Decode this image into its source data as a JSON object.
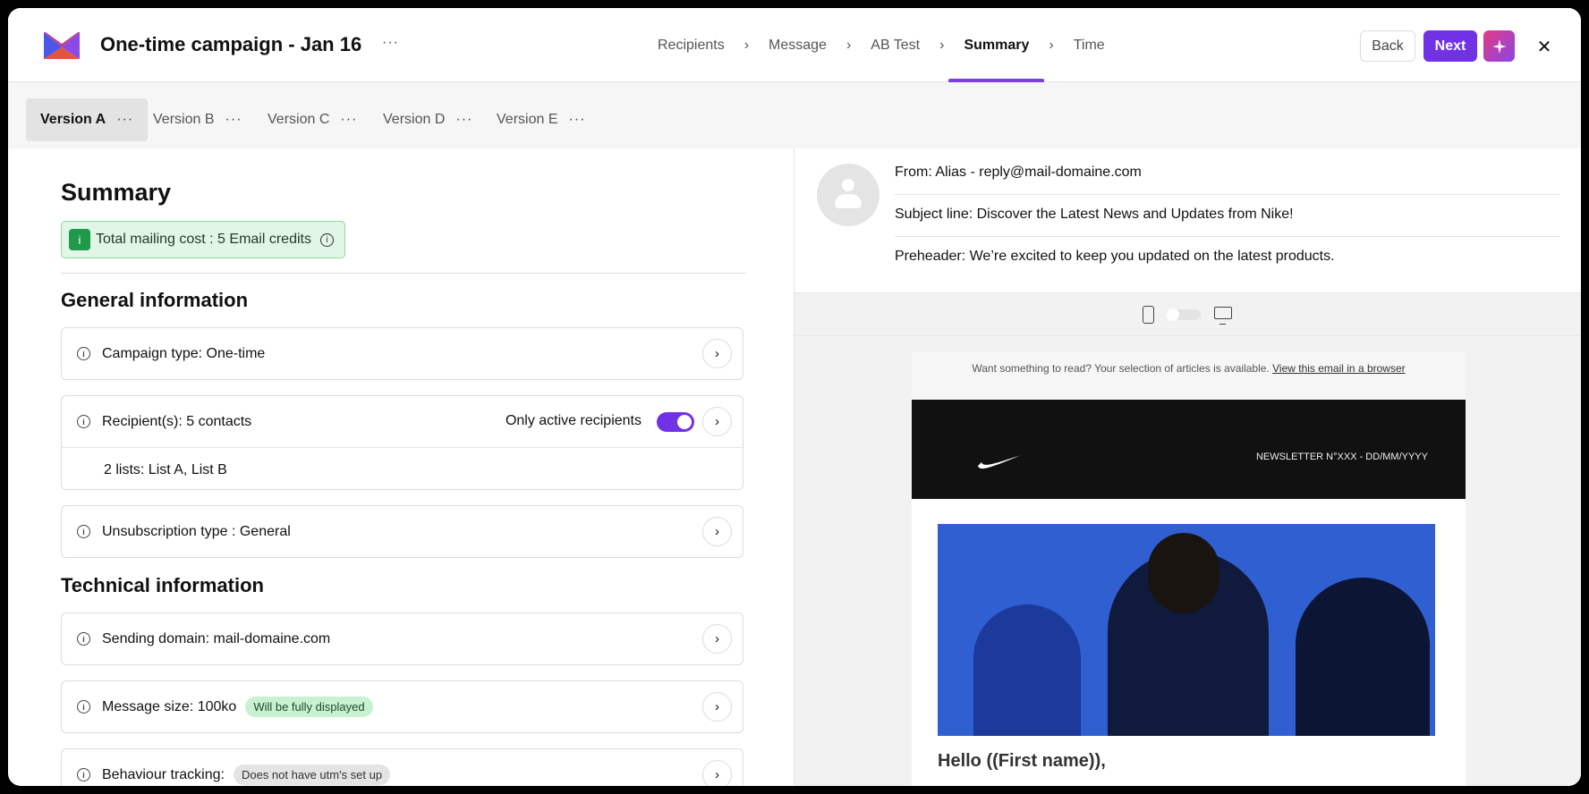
{
  "header": {
    "title": "One-time campaign - Jan 16",
    "more": "···",
    "steps": [
      {
        "label": "Recipients"
      },
      {
        "label": "Message"
      },
      {
        "label": "AB Test"
      },
      {
        "label": "Summary"
      },
      {
        "label": "Time"
      }
    ],
    "step_separator": "›",
    "active_step": "Summary",
    "back_label": "Back",
    "next_label": "Next",
    "ai_icon": "sparkle-icon",
    "close_icon": "close-icon",
    "close_glyph": "✕"
  },
  "versions": {
    "tabs": [
      {
        "label": "Version A",
        "dots": "···"
      },
      {
        "label": "Version B",
        "dots": "···"
      },
      {
        "label": "Version C",
        "dots": "···"
      },
      {
        "label": "Version D",
        "dots": "···"
      },
      {
        "label": "Version E",
        "dots": "···"
      }
    ],
    "active": "Version A"
  },
  "summary": {
    "heading": "Summary",
    "cost_text": "Total mailing cost : 5 Email credits",
    "general_heading": "General information",
    "campaign_type": "Campaign type: One-time",
    "recipients": "Recipient(s): 5 contacts",
    "only_active_label": "Only active recipients",
    "only_active_on": true,
    "lists": "2 lists: List A, List B",
    "unsubscription": "Unsubscription type : General",
    "technical_heading": "Technical  information",
    "sending_domain": "Sending domain: mail-domaine.com",
    "message_size": "Message size: 100ko",
    "message_size_badge": "Will be fully displayed",
    "behaviour": "Behaviour tracking:",
    "behaviour_badge": "Does not have utm's set up",
    "chevron": "›",
    "info_glyph": "i"
  },
  "preview": {
    "from": "From: Alias - reply@mail-domaine.com",
    "subject": "Subject line:  Discover the Latest News and Updates from Nike!",
    "preheader": "Preheader:  We’re excited to keep you updated on the latest products.",
    "email_top_text": "Want something to read? Your selection of articles is available.",
    "email_top_link": "View this email in a browser",
    "newsletter_label": "NEWSLETTER N°XXX - DD/MM/YYYY",
    "greeting": "Hello ((First name)),"
  },
  "colors": {
    "accent": "#7132e6",
    "success_bg": "#e1f6e6",
    "success": "#1f9a4b"
  }
}
